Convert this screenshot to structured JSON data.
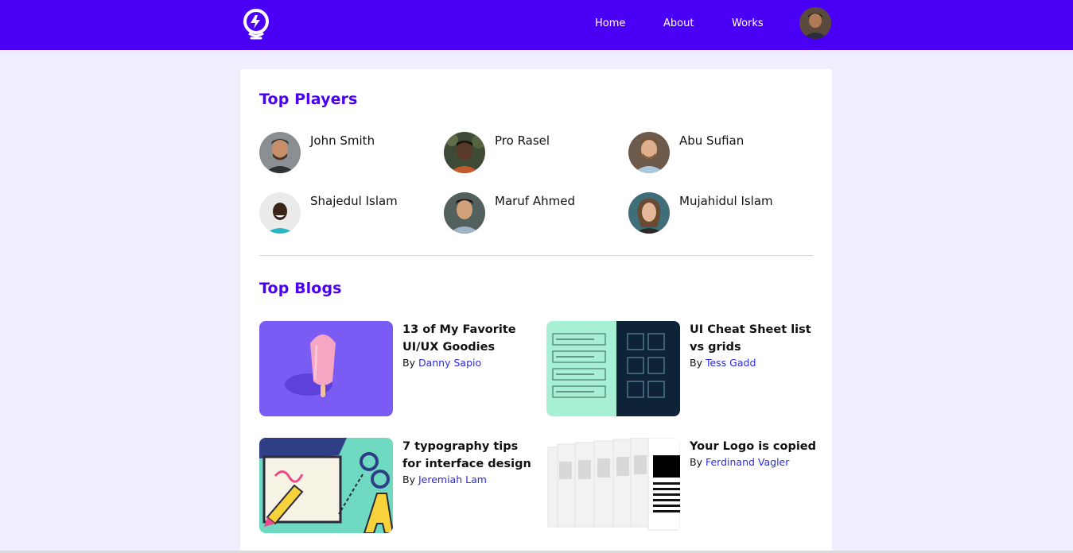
{
  "nav": {
    "logo_icon": "lightbulb-bolt-icon",
    "links": [
      "Home",
      "About",
      "Works"
    ],
    "avatar_icon": "user-avatar"
  },
  "players": {
    "title": "Top Players",
    "items": [
      {
        "name": "John Smith"
      },
      {
        "name": "Pro Rasel"
      },
      {
        "name": "Abu Sufian"
      },
      {
        "name": "Shajedul Islam"
      },
      {
        "name": "Maruf Ahmed"
      },
      {
        "name": "Mujahidul Islam"
      }
    ]
  },
  "blogs": {
    "title": "Top Blogs",
    "by_label": "By",
    "items": [
      {
        "title": "13 of My Favorite UI/UX Goodies",
        "author": "Danny Sapio"
      },
      {
        "title": "UI Cheat Sheet list vs grids",
        "author": "Tess Gadd"
      },
      {
        "title": "7 typography tips for interface design",
        "author": "Jeremiah Lam"
      },
      {
        "title": "Your Logo is copied",
        "author": "Ferdinand Vagler"
      }
    ]
  },
  "colors": {
    "brand": "#4a00f5",
    "page_bg": "#f0eefe",
    "author_link": "#2a2ae6"
  }
}
